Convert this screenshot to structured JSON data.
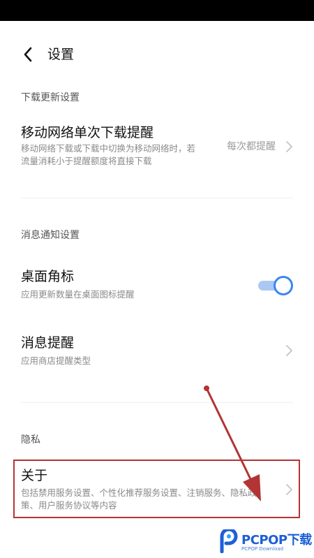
{
  "header": {
    "title": "设置"
  },
  "sections": [
    {
      "title": "下载更新设置",
      "items": [
        {
          "title": "移动网络单次下载提醒",
          "desc": "移动网络下载或下载中切换为移动网络时，若流量消耗小于提醒额度将直接下载",
          "value": "每次都提醒"
        }
      ]
    },
    {
      "title": "消息通知设置",
      "items": [
        {
          "title": "桌面角标",
          "desc": "应用更新数量在桌面图标提醒",
          "toggle_on": true
        },
        {
          "title": "消息提醒",
          "desc": "应用商店提醒类型"
        }
      ]
    },
    {
      "title": "隐私",
      "items": [
        {
          "title": "关于",
          "desc": "包括禁用服务设置、个性化推荐服务设置、注销服务、隐私政策、用户服务协议等内容"
        }
      ]
    }
  ],
  "colors": {
    "accent": "#3a86f0",
    "annotation": "#b23434",
    "watermark": "#1d5fd6"
  },
  "watermark": {
    "brand": "PCPOP下载",
    "sub": "PCPOP Download"
  }
}
